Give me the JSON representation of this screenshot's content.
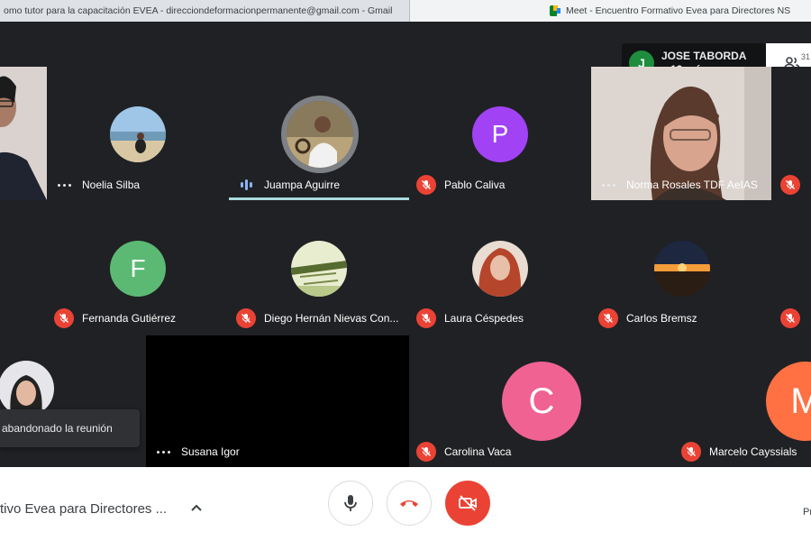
{
  "browser": {
    "tab_gmail": "omo tutor para la capacitación EVEA - direcciondeformacionpermanente@gmail.com - Gmail",
    "tab_meet": "Meet - Encuentro Formativo Evea para Directores NS"
  },
  "presenter": {
    "initial": "J",
    "name": "JOSE TABORDA",
    "more": "y 13 más"
  },
  "people_count": "31",
  "participants": [
    {
      "name": "Noelia Silba",
      "status": "dots",
      "avatar": "photo-beach"
    },
    {
      "name": "Juampa Aguirre",
      "status": "speaking",
      "avatar": "photo-man"
    },
    {
      "name": "Pablo Caliva",
      "status": "muted",
      "initial": "P",
      "avatar_color": "#a142f4"
    },
    {
      "name": "Norma Rosales TDF AeIAS",
      "status": "dots",
      "avatar": "video-woman"
    },
    {
      "name": "Fernanda Gutiérrez",
      "status": "muted",
      "initial": "F",
      "avatar_color": "#5bb974"
    },
    {
      "name": "Diego Hernán Nievas Con...",
      "status": "muted",
      "avatar": "photo-field"
    },
    {
      "name": "Laura Céspedes",
      "status": "muted",
      "avatar": "photo-red"
    },
    {
      "name": "Carlos Bremsz",
      "status": "muted",
      "avatar": "photo-sunset"
    },
    {
      "name": "Susana Igor",
      "status": "dots",
      "avatar": "video-off"
    },
    {
      "name": "Carolina Vaca",
      "status": "muted",
      "initial": "C",
      "avatar_color": "#f06292"
    },
    {
      "name": "Marcelo Cayssials",
      "status": "muted",
      "initial": "M",
      "avatar_color": "#ff7043"
    }
  ],
  "notification": "abandonado la reunión",
  "meeting_title": "tivo Evea para Directores ...",
  "present_label": "Pr",
  "colors": {
    "accent_red": "#ea4335",
    "speaking_blue": "#8ab4f8",
    "meet_bg": "#202124",
    "tile_bg": "#3c4043"
  },
  "icons": [
    "mic-icon",
    "hang-up-icon",
    "camera-off-icon",
    "people-icon",
    "chevron-up-icon",
    "mic-off-icon"
  ]
}
